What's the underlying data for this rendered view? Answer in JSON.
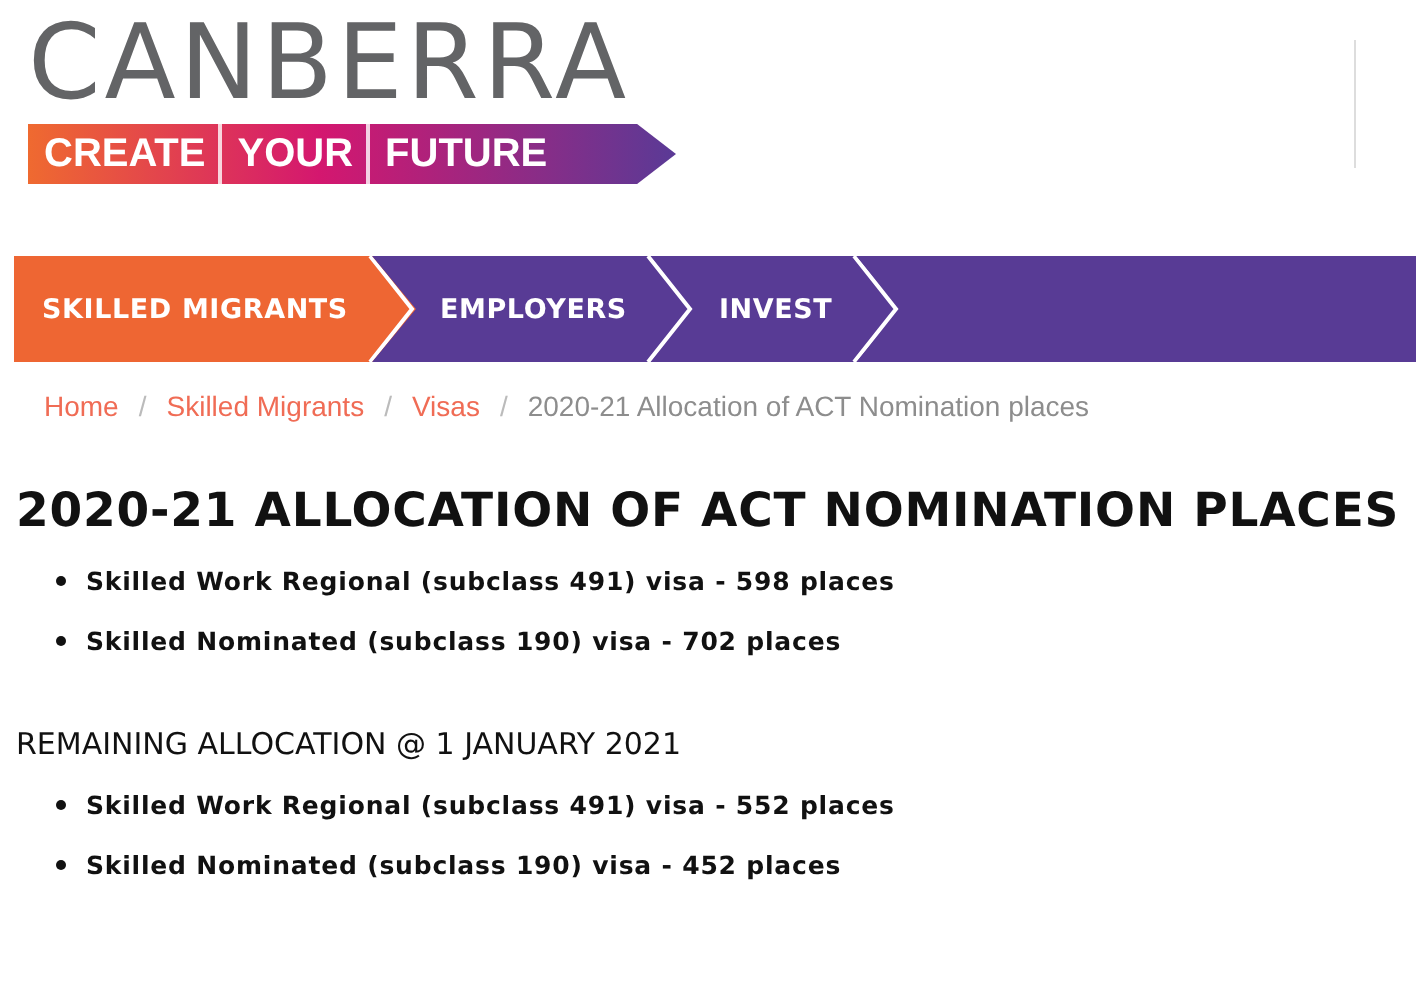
{
  "logo": {
    "title": "CANBERRA",
    "tagline": [
      "CREATE",
      "YOUR",
      "FUTURE"
    ]
  },
  "nav": [
    {
      "label": "SKILLED MIGRANTS",
      "selected": true
    },
    {
      "label": "EMPLOYERS",
      "selected": false
    },
    {
      "label": "INVEST",
      "selected": false
    }
  ],
  "breadcrumb": [
    {
      "label": "Home",
      "kind": "link"
    },
    {
      "label": "Skilled Migrants",
      "kind": "link"
    },
    {
      "label": "Visas",
      "kind": "link"
    },
    {
      "label": "2020-21 Allocation of ACT Nomination places",
      "kind": "current"
    }
  ],
  "heading": "2020-21 ALLOCATION OF ACT NOMINATION PLACES",
  "breadcrumb_separator": "/",
  "sections": [
    {
      "items": [
        "Skilled Work Regional (subclass 491) visa - 598 places",
        "Skilled Nominated (subclass 190) visa - 702 places"
      ]
    },
    {
      "title": "REMAINING ALLOCATION @ 1 JANUARY 2021",
      "items": [
        "Skilled Work Regional (subclass 491) visa - 552 places",
        "Skilled Nominated (subclass 190) visa - 452 places"
      ]
    }
  ]
}
